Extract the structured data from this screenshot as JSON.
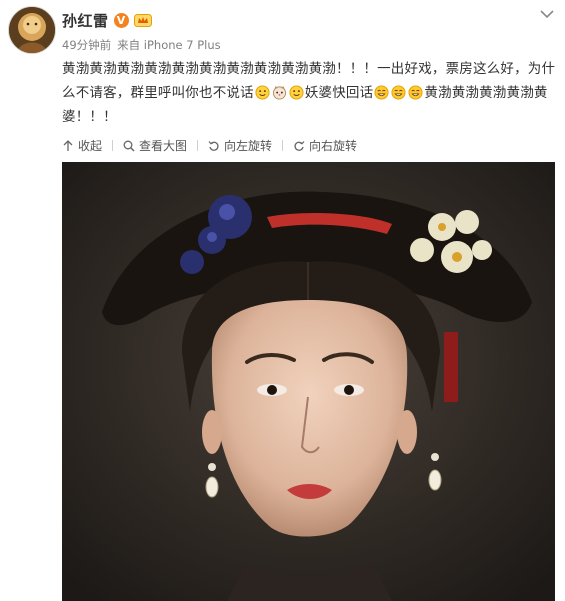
{
  "post": {
    "username": "孙红雷",
    "vip_badge": "V",
    "time": "49分钟前",
    "source": "来自 iPhone 7 Plus",
    "text_part1": "黄渤黄渤黄渤黄渤黄渤黄渤黄渤黄渤黄渤黄渤！！！一出好戏，票房这么好，为什么不请客，群里呼叫你也不说话",
    "text_part2": "妖婆快回话",
    "text_part3": "黄渤黄渤黄渤黄渤黄婆！！！",
    "icons": {
      "avatar": "avatar-icon",
      "vip": "verified-badge-icon",
      "member": "member-crown-icon",
      "menu": "chevron-down-icon",
      "emoji_a": "smiley-emoji-icon",
      "emoji_b": "cat-emoji-icon",
      "emoji_c": "grin-emoji-icon"
    }
  },
  "toolbar": {
    "collapse": "收起",
    "view_large": "查看大图",
    "rotate_left": "向左旋转",
    "rotate_right": "向右旋转"
  },
  "colors": {
    "text": "#333333",
    "meta": "#808080",
    "badge": "#f58220"
  }
}
